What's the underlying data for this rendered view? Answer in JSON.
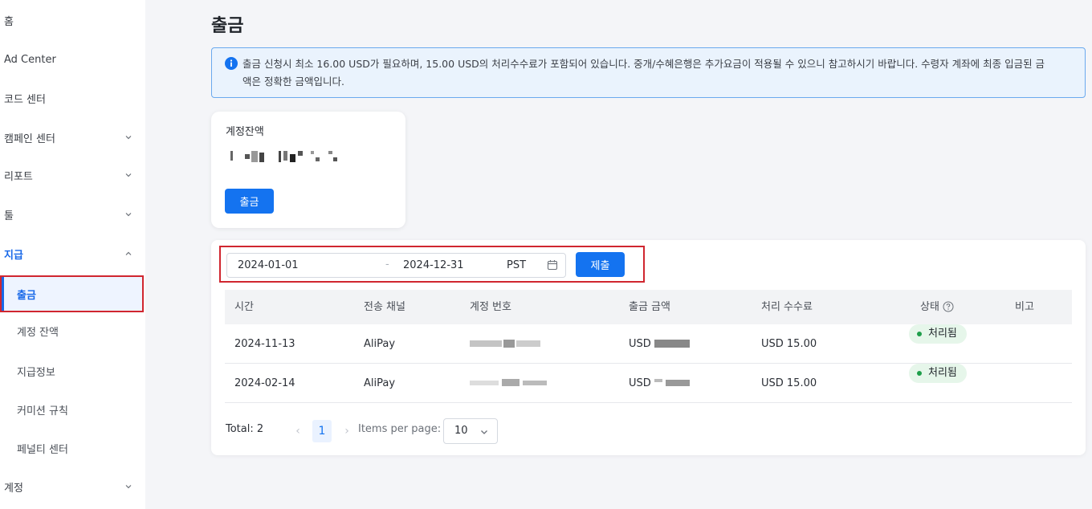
{
  "sidebar": {
    "items": [
      {
        "label": "홈",
        "has_chevron": false
      },
      {
        "label": "Ad Center",
        "has_chevron": false
      },
      {
        "label": "코드 센터",
        "has_chevron": false
      },
      {
        "label": "캠페인 센터",
        "has_chevron": true
      },
      {
        "label": "리포트",
        "has_chevron": true
      },
      {
        "label": "툴",
        "has_chevron": true
      },
      {
        "label": "지급",
        "has_chevron": true,
        "expanded": true
      },
      {
        "label": "출금",
        "selected": true
      },
      {
        "label": "계정 잔액"
      },
      {
        "label": "지급정보"
      },
      {
        "label": "커미션 규칙"
      },
      {
        "label": "페널티 센터"
      },
      {
        "label": "계정",
        "has_chevron": true
      }
    ]
  },
  "page": {
    "title": "출금",
    "notice": "출금 신청시 최소 16.00 USD가 필요하며, 15.00 USD의 처리수수료가 포함되어 있습니다. 중개/수혜은행은 추가요금이 적용될 수 있으니 참고하시기 바랍니다. 수령자 계좌에 최종 입금된 금액은 정확한 금액입니다."
  },
  "balance": {
    "caption": "계정잔액",
    "withdraw_label": "출금"
  },
  "filter": {
    "start_date": "2024-01-01",
    "separator": "-",
    "end_date": "2024-12-31",
    "timezone": "PST",
    "submit_label": "제출"
  },
  "table": {
    "columns": [
      "시간",
      "전송 채널",
      "계정 번호",
      "출금 금액",
      "처리 수수료",
      "상태",
      "비고"
    ],
    "rows": [
      {
        "time": "2024-11-13",
        "channel": "AliPay",
        "amount_prefix": "USD",
        "fee": "USD 15.00",
        "status": "처리됨",
        "note": ""
      },
      {
        "time": "2024-02-14",
        "channel": "AliPay",
        "amount_prefix": "USD",
        "fee": "USD 15.00",
        "status": "처리됨",
        "note": ""
      }
    ]
  },
  "pagination": {
    "total": "Total: 2",
    "prev": "‹",
    "current_page": "1",
    "next": "›",
    "items_per_page_label": "Items per page:",
    "items_per_page": "10"
  },
  "colors": {
    "primary": "#1473f0",
    "highlight_border": "#d0262f",
    "status_green": "#1e9e4a"
  }
}
